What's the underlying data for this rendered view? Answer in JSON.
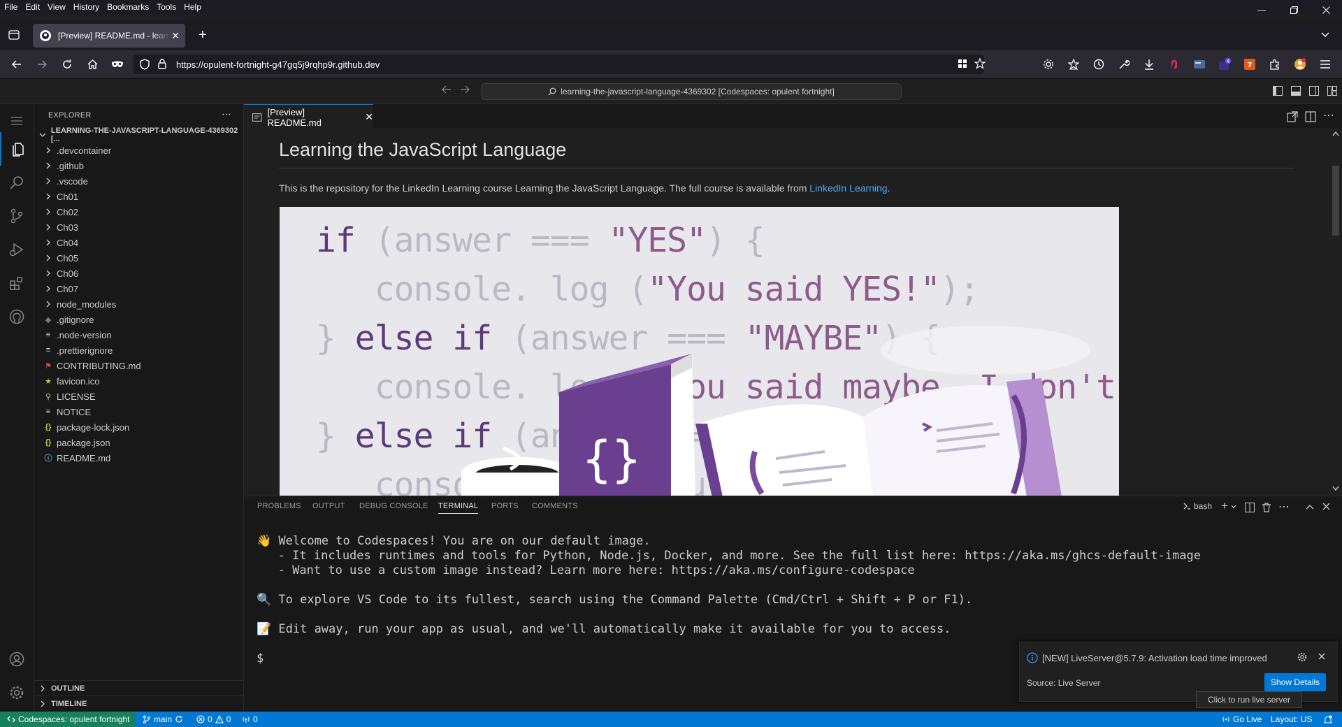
{
  "browser": {
    "menu": [
      "File",
      "Edit",
      "View",
      "History",
      "Bookmarks",
      "Tools",
      "Help"
    ],
    "tab_title": "[Preview] README.md - learning-the-javascript-language",
    "url": "https://opulent-fortnight-g47gq5j9rqhp9r.github.dev"
  },
  "vscode": {
    "command_center": "learning-the-javascript-language-4369302 [Codespaces: opulent fortnight]",
    "explorer": {
      "header": "EXPLORER",
      "root": "LEARNING-THE-JAVASCRIPT-LANGUAGE-4369302 [...",
      "folders": [
        ".devcontainer",
        ".github",
        ".vscode",
        "Ch01",
        "Ch02",
        "Ch03",
        "Ch04",
        "Ch05",
        "Ch06",
        "Ch07",
        "node_modules"
      ],
      "files": [
        ".gitignore",
        ".node-version",
        ".prettierignore",
        "CONTRIBUTING.md",
        "favicon.ico",
        "LICENSE",
        "NOTICE",
        "package-lock.json",
        "package.json",
        "README.md"
      ],
      "file_icon_glyphs": [
        "◆",
        "≡",
        "≡",
        "⚑",
        "★",
        "⚲",
        "≡",
        "{}",
        "{}",
        "ⓘ"
      ],
      "file_icon_colors": [
        "#6d8086",
        "#cccccc",
        "#cccccc",
        "#e04e4e",
        "#cbcb41",
        "#cbcb41",
        "#cccccc",
        "#cbcb41",
        "#cbcb41",
        "#519aba"
      ],
      "outline": "OUTLINE",
      "timeline": "TIMELINE"
    },
    "editor_tab": "[Preview] README.md",
    "preview": {
      "title": "Learning the JavaScript Language",
      "paragraph": "This is the repository for the LinkedIn Learning course Learning the JavaScript Language. The full course is available from ",
      "link": "LinkedIn Learning",
      "paragraph_end": ".",
      "banner_code": [
        "if (answer === \"YES\") {",
        "   console. log (\"You said YES!\");",
        "} else if (answer === \"MAYBE\") {",
        "   console. log (\"You said maybe. I don't",
        "} else if (answer ===",
        "   console.log (\"You s"
      ]
    },
    "panel": {
      "tabs": [
        "PROBLEMS",
        "OUTPUT",
        "DEBUG CONSOLE",
        "TERMINAL",
        "PORTS",
        "COMMENTS"
      ],
      "active_tab": "TERMINAL",
      "shell": "bash",
      "terminal": [
        "👋 Welcome to Codespaces! You are on our default image.",
        "   - It includes runtimes and tools for Python, Node.js, Docker, and more. See the full list here: https://aka.ms/ghcs-default-image",
        "   - Want to use a custom image instead? Learn more here: https://aka.ms/configure-codespace",
        "🔍 To explore VS Code to its fullest, search using the Command Palette (Cmd/Ctrl + Shift + P or F1).",
        "📝 Edit away, run your app as usual, and we'll automatically make it available for you to access.",
        "$"
      ]
    },
    "notification": {
      "message": "[NEW] LiveServer@5.7.9: Activation load time improved",
      "source": "Source: Live Server",
      "button": "Show Details",
      "tooltip": "Click to run live server"
    },
    "statusbar": {
      "remote": "Codespaces: opulent fortnight",
      "branch": "main",
      "errors": "0",
      "warnings": "0",
      "ports": "0",
      "go_live": "Go Live",
      "layout": "Layout: US"
    }
  },
  "colors": {
    "accent": "#0078d4",
    "remote": "#16825d",
    "link": "#4daafc",
    "banner_keyword": "#5c3a7a",
    "banner_string": "#8e5a8c",
    "banner_dim": "#b9b9c3"
  }
}
